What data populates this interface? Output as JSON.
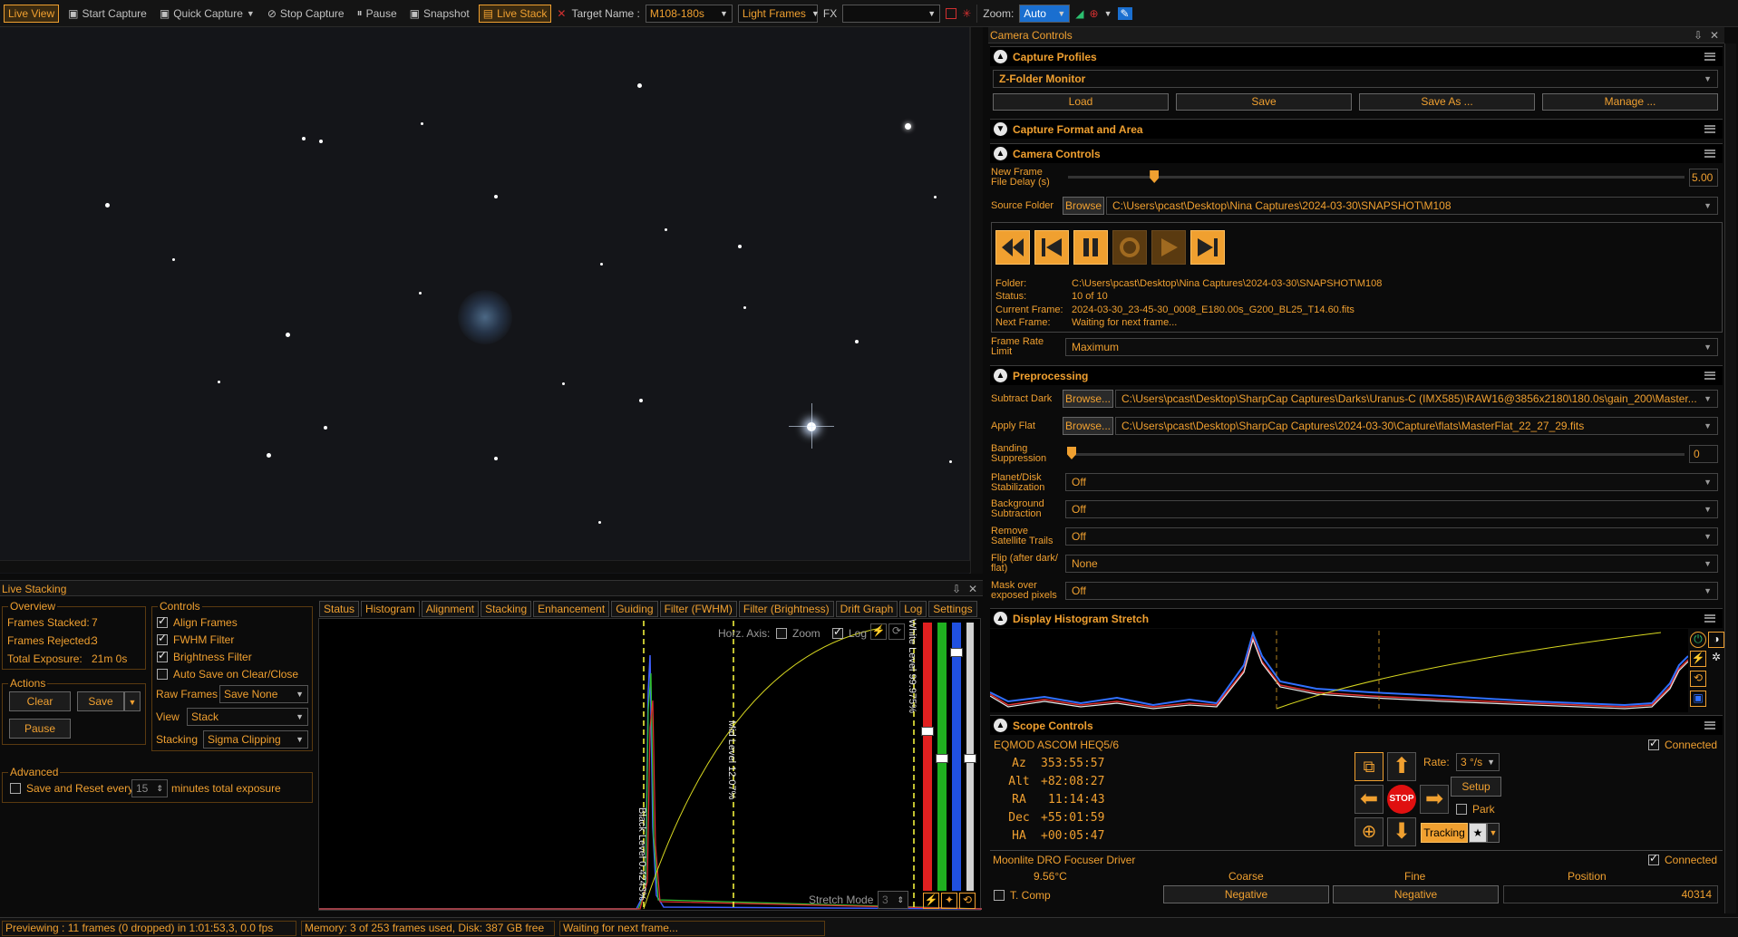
{
  "toolbar": {
    "live_view": "Live View",
    "start_capture": "Start Capture",
    "quick_capture": "Quick Capture",
    "stop_capture": "Stop Capture",
    "pause": "Pause",
    "snapshot": "Snapshot",
    "live_stack": "Live Stack",
    "target_name_label": "Target Name :",
    "target_name_value": "M108-180s",
    "frame_type": "Light Frames",
    "fx_label": "FX",
    "fx_value": "",
    "zoom_label": "Zoom:",
    "zoom_value": "Auto"
  },
  "live_stacking": {
    "title": "Live Stacking",
    "overview": {
      "title": "Overview",
      "frames_stacked_label": "Frames Stacked:",
      "frames_stacked": "7",
      "frames_rejected_label": "Frames Rejected:",
      "frames_rejected": "3",
      "total_exposure_label": "Total Exposure:",
      "total_exposure": "21m 0s"
    },
    "actions": {
      "title": "Actions",
      "clear": "Clear",
      "save": "Save",
      "pause": "Pause"
    },
    "controls": {
      "title": "Controls",
      "align_frames": "Align Frames",
      "fwhm_filter": "FWHM Filter",
      "brightness_filter": "Brightness Filter",
      "auto_save": "Auto Save on Clear/Close",
      "raw_frames_label": "Raw Frames",
      "raw_frames_value": "Save None",
      "view_label": "View",
      "view_value": "Stack",
      "stacking_label": "Stacking",
      "stacking_value": "Sigma Clipping"
    },
    "advanced": {
      "title": "Advanced",
      "save_reset_label": "Save and Reset every",
      "minutes_value": "15",
      "minutes_suffix": "minutes total exposure"
    },
    "tabs": [
      "Status",
      "Histogram",
      "Alignment",
      "Stacking",
      "Enhancement",
      "Guiding",
      "Filter (FWHM)",
      "Filter (Brightness)",
      "Drift Graph",
      "Log",
      "Settings"
    ],
    "active_tab": "Histogram",
    "histogram": {
      "horz_axis_label": "Horz. Axis:",
      "zoom_label": "Zoom",
      "log_label": "Log",
      "black_level": "Black Level 0.4243%",
      "mid_level": "Mid Level 12.07%",
      "white_level": "White Level 99.975%",
      "stretch_mode_label": "Stretch Mode",
      "stretch_mode_value": "3"
    }
  },
  "camera_controls_panel": {
    "title": "Camera Controls",
    "capture_profiles": {
      "title": "Capture Profiles",
      "selected": "Z-Folder Monitor",
      "load": "Load",
      "save": "Save",
      "save_as": "Save As ...",
      "manage": "Manage ..."
    },
    "capture_format": {
      "title": "Capture Format and Area"
    },
    "camera_controls": {
      "title": "Camera Controls",
      "new_frame_delay_label": "New Frame File Delay (s)",
      "new_frame_delay_value": "5.00",
      "new_frame_delay_fraction": 0.14,
      "source_folder_label": "Source Folder",
      "browse": "Browse",
      "source_folder_value": "C:\\Users\\pcast\\Desktop\\Nina Captures\\2024-03-30\\SNAPSHOT\\M108",
      "folder_label": "Folder:",
      "folder_value": "C:\\Users\\pcast\\Desktop\\Nina Captures\\2024-03-30\\SNAPSHOT\\M108",
      "status_label": "Status:",
      "status_value": "10 of 10",
      "current_frame_label": "Current Frame:",
      "current_frame_value": "2024-03-30_23-45-30_0008_E180.00s_G200_BL25_T14.60.fits",
      "next_frame_label": "Next Frame:",
      "next_frame_value": "Waiting for next frame...",
      "frame_rate_label": "Frame Rate Limit",
      "frame_rate_value": "Maximum"
    },
    "preprocessing": {
      "title": "Preprocessing",
      "subtract_dark_label": "Subtract Dark",
      "browse": "Browse...",
      "subtract_dark_value": "C:\\Users\\pcast\\Desktop\\SharpCap Captures\\Darks\\Uranus-C (IMX585)\\RAW16@3856x2180\\180.0s\\gain_200\\Master...",
      "apply_flat_label": "Apply Flat",
      "apply_flat_value": "C:\\Users\\pcast\\Desktop\\SharpCap Captures\\2024-03-30\\Capture\\flats\\MasterFlat_22_27_29.fits",
      "banding_label": "Banding Suppression",
      "banding_value": "0",
      "banding_fraction": 0.0,
      "planet_label": "Planet/Disk Stabilization",
      "planet_value": "Off",
      "bg_sub_label": "Background Subtraction",
      "bg_sub_value": "Off",
      "sat_trails_label": "Remove Satellite Trails",
      "sat_trails_value": "Off",
      "flip_label": "Flip (after dark/ flat)",
      "flip_value": "None",
      "mask_label": "Mask over exposed pixels",
      "mask_value": "Off"
    },
    "display_histogram": {
      "title": "Display Histogram Stretch"
    },
    "scope_controls": {
      "title": "Scope Controls",
      "mount_name": "EQMOD ASCOM HEQ5/6",
      "connected_label": "Connected",
      "az_label": "Az",
      "az_value": "353:55:57",
      "alt_label": "Alt",
      "alt_value": "+82:08:27",
      "ra_label": "RA",
      "ra_value": "11:14:43",
      "dec_label": "Dec",
      "dec_value": "+55:01:59",
      "ha_label": "HA",
      "ha_value": "+00:05:47",
      "rate_label": "Rate:",
      "rate_value": "3 °/s",
      "stop_label": "STOP",
      "setup": "Setup",
      "park": "Park",
      "tracking": "Tracking"
    },
    "focuser": {
      "name": "Moonlite DRO Focuser Driver",
      "connected_label": "Connected",
      "temperature": "9.56°C",
      "t_comp": "T. Comp",
      "coarse_label": "Coarse",
      "fine_label": "Fine",
      "position_label": "Position",
      "coarse_negative": "Negative",
      "fine_negative": "Negative",
      "position_value": "40314"
    }
  },
  "status_bar": {
    "previewing": "Previewing : 11 frames (0 dropped) in 1:01:53,3, 0.0 fps",
    "memory": "Memory: 3 of 253 frames used, Disk: 387 GB free",
    "waiting": "Waiting for next frame..."
  },
  "colors": {
    "accent": "#f0a030",
    "background": "#0b0b0b",
    "stop": "#e01010"
  }
}
